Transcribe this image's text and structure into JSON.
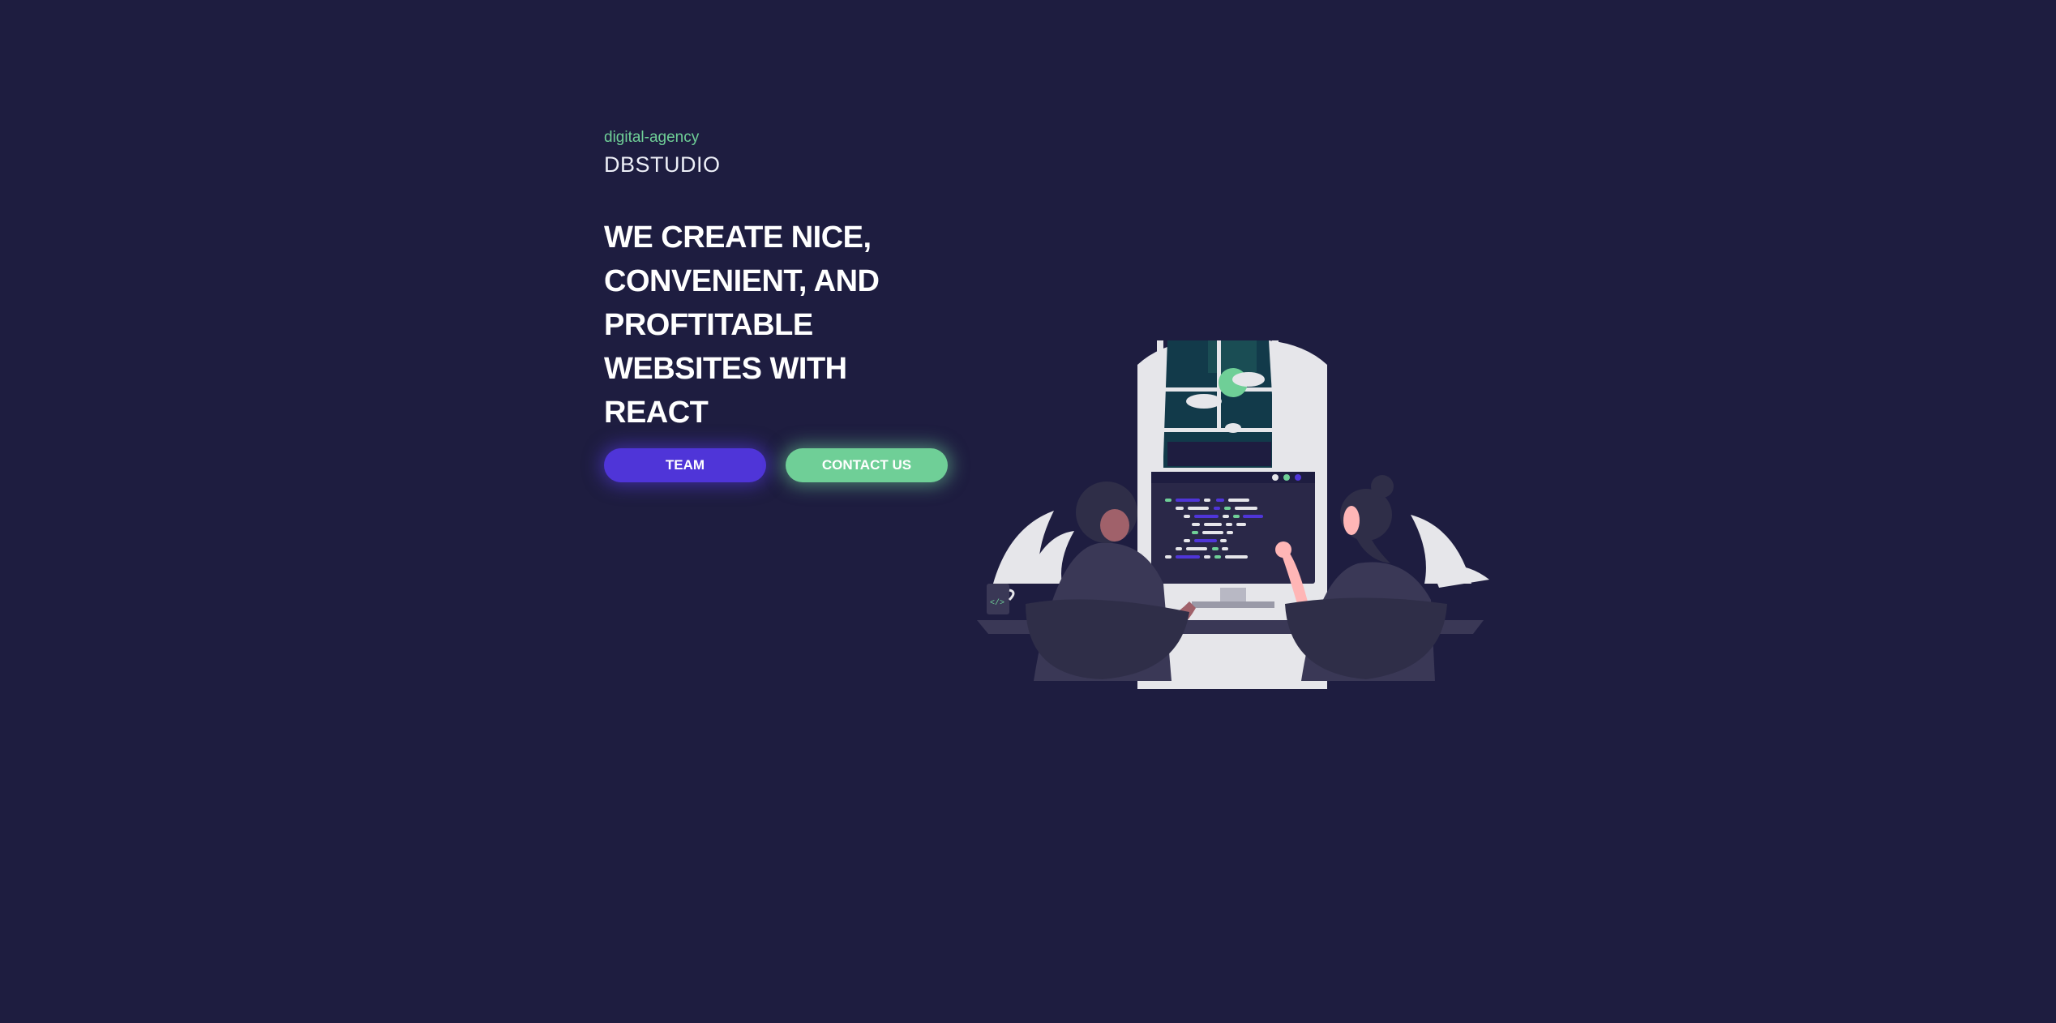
{
  "hero": {
    "tagline": "digital-agency",
    "brand": "DBSTUDIO",
    "headline_lines": [
      "WE CREATE NICE,",
      "CONVENIENT, AND",
      "PROFTITABLE",
      "WEBSITES WITH",
      "REACT"
    ]
  },
  "buttons": {
    "team_label": "TEAM",
    "contact_label": "CONTACT US"
  },
  "illustration": {
    "icon": "developers-at-desk-illustration",
    "mug_label": "</>"
  },
  "colors": {
    "background": "#1e1d40",
    "accent_green": "#6fcf97",
    "accent_purple": "#4f35d8",
    "text": "#ffffff"
  }
}
